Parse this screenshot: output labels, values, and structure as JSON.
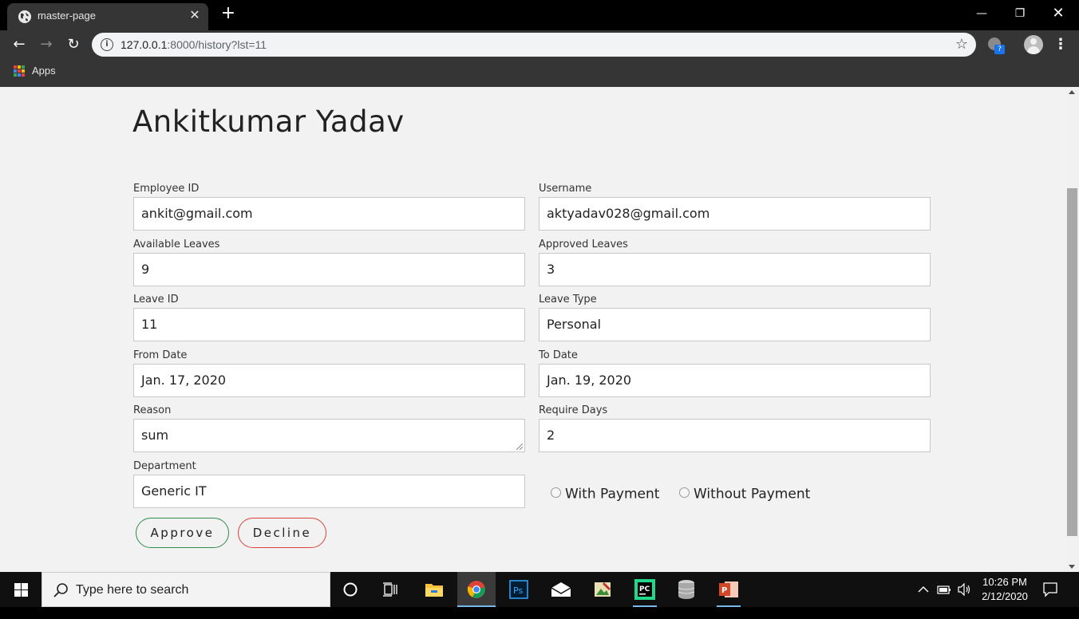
{
  "browser": {
    "tab_title": "master-page",
    "url_host": "127.0.0.1",
    "url_path": ":8000/history?lst=11",
    "bookmark_apps": "Apps"
  },
  "page": {
    "title": "Ankitkumar Yadav",
    "fields": {
      "employee_id": {
        "label": "Employee ID",
        "value": "ankit@gmail.com"
      },
      "username": {
        "label": "Username",
        "value": "aktyadav028@gmail.com"
      },
      "available_leaves": {
        "label": "Available Leaves",
        "value": "9"
      },
      "approved_leaves": {
        "label": "Approved Leaves",
        "value": "3"
      },
      "leave_id": {
        "label": "Leave ID",
        "value": "11"
      },
      "leave_type": {
        "label": "Leave Type",
        "value": "Personal"
      },
      "from_date": {
        "label": "From Date",
        "value": "Jan. 17, 2020"
      },
      "to_date": {
        "label": "To Date",
        "value": "Jan. 19, 2020"
      },
      "reason": {
        "label": "Reason",
        "value": "sum"
      },
      "require_days": {
        "label": "Require Days",
        "value": "2"
      },
      "department": {
        "label": "Department",
        "value": "Generic IT"
      }
    },
    "payment_options": [
      "With Payment",
      "Without Payment"
    ],
    "buttons": {
      "approve": "Approve",
      "decline": "Decline"
    },
    "colors": {
      "approve_border": "#2e8b4a",
      "decline_border": "#d9453a",
      "background": "#f2f2f2"
    }
  },
  "taskbar": {
    "search_placeholder": "Type here to search",
    "time": "10:26 PM",
    "date": "2/12/2020"
  }
}
